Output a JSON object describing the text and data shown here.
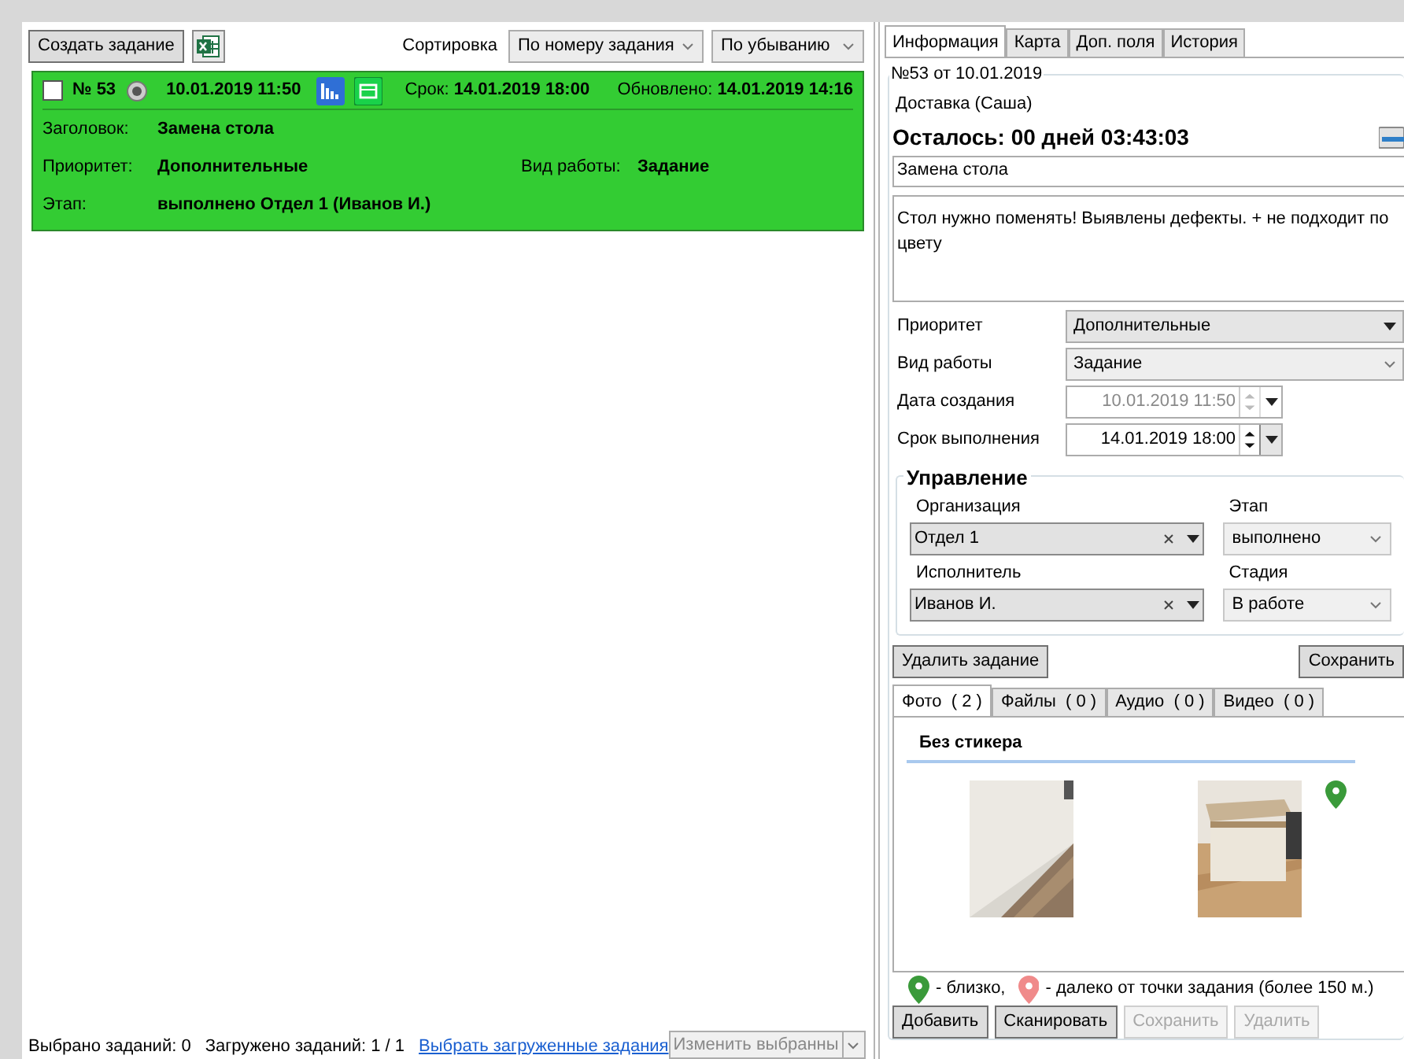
{
  "toolbar": {
    "create_button": "Создать задание",
    "sort_label": "Сортировка",
    "sort_by": "По номеру задания",
    "sort_order": "По убыванию"
  },
  "tasks": [
    {
      "checked": false,
      "number": "№ 53",
      "created": "10.01.2019 11:50",
      "due_label": "Срок:",
      "due": "14.01.2019 18:00",
      "updated_label": "Обновлено:",
      "updated": "14.01.2019 14:16",
      "color": "#33cc33",
      "rows": [
        [
          {
            "label": "Заголовок:",
            "value": "Замена стола"
          }
        ],
        [
          {
            "label": "Приоритет:",
            "value": "Дополнительные"
          },
          {
            "label": "Вид работы:",
            "value": "Задание"
          }
        ],
        [
          {
            "label": "Этап:",
            "value": "выполнено Отдел 1 (Иванов И.)"
          }
        ]
      ]
    }
  ],
  "status_bar": {
    "selected": "Выбрано заданий: 0",
    "loaded": "Загружено заданий: 1 / 1",
    "link": "Выбрать загруженные задания",
    "action": "Изменить выбранны"
  },
  "detail": {
    "tabs": [
      {
        "label": "Информация",
        "selected": true
      },
      {
        "label": "Карта",
        "selected": false
      },
      {
        "label": "Доп. поля",
        "selected": false
      },
      {
        "label": "История",
        "selected": false
      }
    ],
    "group_title": "№53 от 10.01.2019",
    "customer": "Доставка (Саша)",
    "remaining": "Осталось: 00 дней 03:43:03",
    "title_value": "Замена стола",
    "description": "Стол нужно поменять! Выявлены дефекты. + не подходит по цвету",
    "form": [
      {
        "kind": "select",
        "label": "Приоритет",
        "value": "Дополнительные"
      },
      {
        "kind": "select",
        "label": "Вид работы",
        "value": "Задание"
      },
      {
        "kind": "datetime",
        "label": "Дата создания",
        "value": "10.01.2019 11:50",
        "disabled": true
      },
      {
        "kind": "datetime",
        "label": "Срок выполнения",
        "value": "14.01.2019 18:00",
        "disabled": false
      }
    ],
    "management": {
      "title": "Управление",
      "rows": [
        [
          {
            "kind": "clearable",
            "label": "Организация",
            "value": "Отдел 1"
          },
          {
            "kind": "select",
            "label": "Этап",
            "value": "выполнено"
          }
        ],
        [
          {
            "kind": "clearable",
            "label": "Исполнитель",
            "value": "Иванов И."
          },
          {
            "kind": "select",
            "label": "Стадия",
            "value": "В работе"
          }
        ]
      ]
    },
    "delete_button": "Удалить задание",
    "save_button": "Сохранить",
    "media_tabs": [
      {
        "label": "Фото  ( 2 )",
        "selected": true
      },
      {
        "label": "Файлы  ( 0 )",
        "selected": false
      },
      {
        "label": "Аудио  ( 0 )",
        "selected": false
      },
      {
        "label": "Видео  ( 0 )",
        "selected": false
      }
    ],
    "sticker_group": "Без стикера",
    "photos": [
      {
        "kind": "picture",
        "near_pin": false
      },
      {
        "kind": "picture",
        "near_pin": true
      }
    ],
    "legend": [
      {
        "kind": "near",
        "text": "- близко,"
      },
      {
        "kind": "far",
        "text": "- далеко от точки задания (более 150 м.)"
      }
    ],
    "media_buttons": [
      {
        "label": "Добавить",
        "disabled": false
      },
      {
        "label": "Сканировать",
        "disabled": false
      },
      {
        "label": "Сохранить",
        "disabled": true
      },
      {
        "label": "Удалить",
        "disabled": true
      }
    ]
  }
}
